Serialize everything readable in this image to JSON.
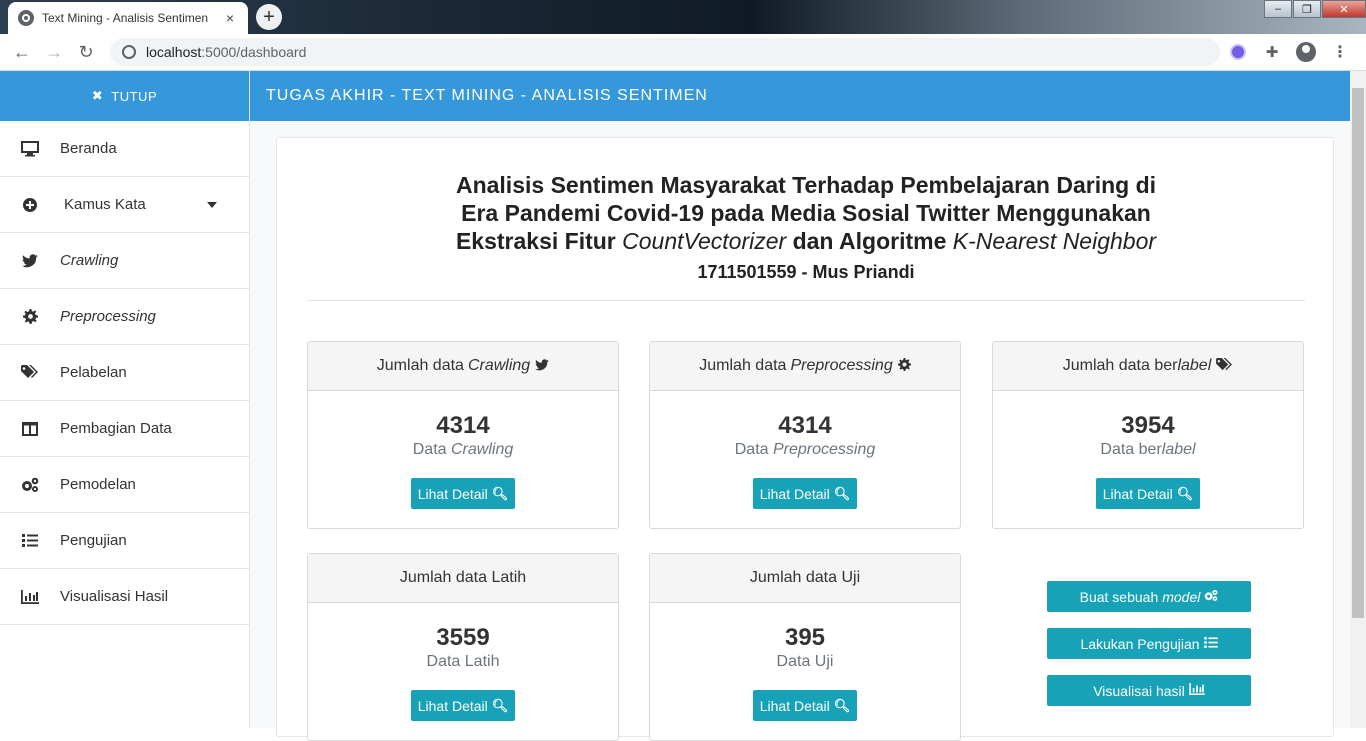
{
  "browser": {
    "tab_title": "Text Mining - Analisis Sentimen",
    "tab_close": "×",
    "new_tab": "+",
    "url_host": "localhost",
    "url_path": ":5000/dashboard"
  },
  "sidebar": {
    "toggle_label": "TUTUP",
    "items": [
      {
        "label": "Beranda",
        "icon": "monitor-icon"
      },
      {
        "label": "Kamus Kata",
        "icon": "plus-circle-icon"
      },
      {
        "label": "Crawling",
        "icon": "twitter-icon"
      },
      {
        "label": "Preprocessing",
        "icon": "cog-icon"
      },
      {
        "label": "Pelabelan",
        "icon": "tags-icon"
      },
      {
        "label": "Pembagian Data",
        "icon": "columns-icon"
      },
      {
        "label": "Pemodelan",
        "icon": "cogs-icon"
      },
      {
        "label": "Pengujian",
        "icon": "list-icon"
      },
      {
        "label": "Visualisasi Hasil",
        "icon": "bar-chart-icon"
      }
    ]
  },
  "topnav": {
    "title": "TUGAS AKHIR - TEXT MINING - ANALISIS SENTIMEN"
  },
  "headline": {
    "line1": "Analisis Sentimen Masyarakat Terhadap Pembelajaran Daring di",
    "line2": "Era Pandemi Covid-19 pada Media Sosial Twitter Menggunakan",
    "line3_a": "Ekstraksi Fitur ",
    "line3_b": "CountVectorizer",
    "line3_c": " dan Algoritme ",
    "line3_d": "K-Nearest Neighbor",
    "student": "1711501559 - Mus Priandi"
  },
  "cards": [
    {
      "head_prefix": "Jumlah data ",
      "head_italic": "Crawling",
      "value": "4314",
      "sub_prefix": "Data ",
      "sub_italic": "Crawling",
      "button": "Lihat Detail",
      "icon": "twitter-icon"
    },
    {
      "head_prefix": "Jumlah data ",
      "head_italic": "Preprocessing",
      "value": "4314",
      "sub_prefix": "Data ",
      "sub_italic": "Preprocessing",
      "button": "Lihat Detail",
      "icon": "cog-icon"
    },
    {
      "head_prefix": "Jumlah data ber",
      "head_italic": "label",
      "value": "3954",
      "sub_prefix": "Data ber",
      "sub_italic": "label",
      "button": "Lihat Detail",
      "icon": "tags-icon"
    },
    {
      "head_prefix": "Jumlah data Latih",
      "head_italic": "",
      "value": "3559",
      "sub_prefix": "Data Latih",
      "sub_italic": "",
      "button": "Lihat Detail",
      "icon": ""
    },
    {
      "head_prefix": "Jumlah data Uji",
      "head_italic": "",
      "value": "395",
      "sub_prefix": "Data Uji",
      "sub_italic": "",
      "button": "Lihat Detail",
      "icon": ""
    }
  ],
  "actions": {
    "model_prefix": "Buat sebuah ",
    "model_italic": "model",
    "test": "Lakukan Pengujian",
    "visual": "Visualisai hasil"
  },
  "colors": {
    "primary": "#3598db",
    "info": "#17a2b8"
  }
}
